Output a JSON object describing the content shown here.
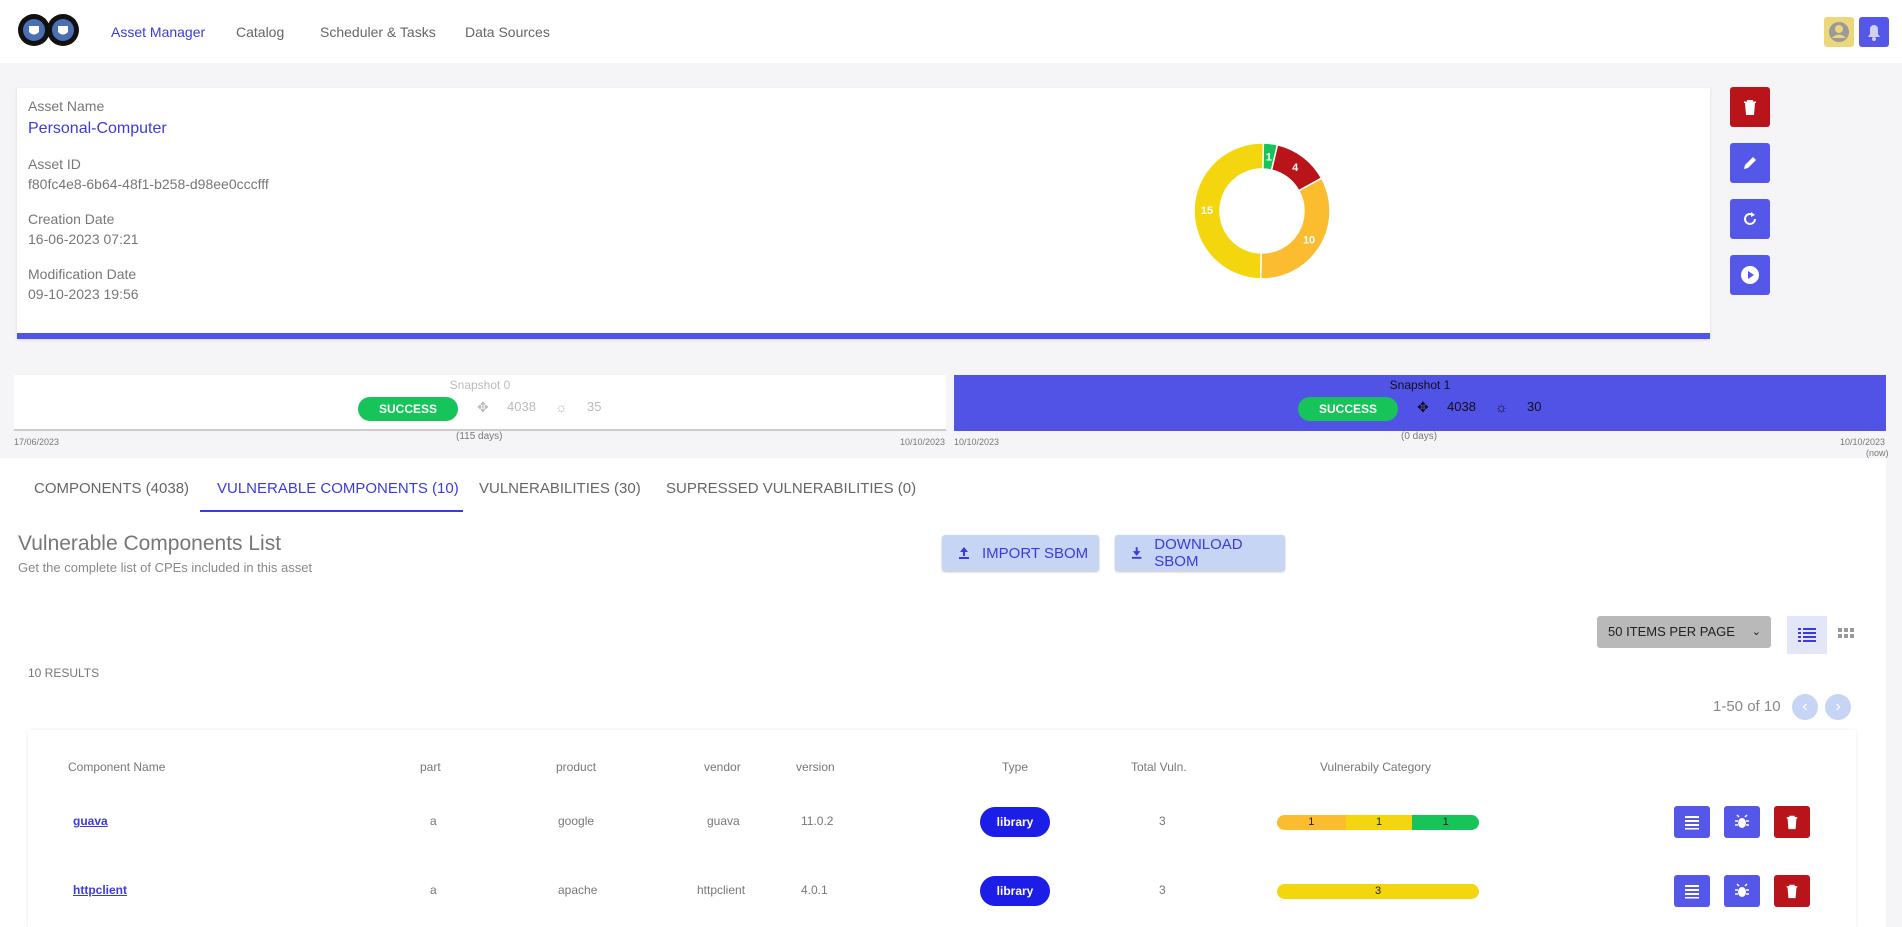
{
  "nav": {
    "items": [
      {
        "label": "Asset Manager",
        "active": true
      },
      {
        "label": "Catalog",
        "active": false
      },
      {
        "label": "Scheduler & Tasks",
        "active": false
      },
      {
        "label": "Data Sources",
        "active": false
      }
    ]
  },
  "asset": {
    "name_label": "Asset Name",
    "name": "Personal-Computer",
    "id_label": "Asset ID",
    "id": "f80fc4e8-6b64-48f1-b258-d98ee0cccfff",
    "creation_label": "Creation Date",
    "creation": "16-06-2023 07:21",
    "modification_label": "Modification Date",
    "modification": "09-10-2023 19:56"
  },
  "severity_chart": {
    "segments": [
      {
        "value": 1,
        "color": "#16c45a"
      },
      {
        "value": 4,
        "color": "#b8141a"
      },
      {
        "value": 10,
        "color": "#fbbc30"
      },
      {
        "value": 15,
        "color": "#f4d60f"
      }
    ]
  },
  "snapshots": [
    {
      "title": "Snapshot 0",
      "status": "SUCCESS",
      "components": "4038",
      "vulns": "35",
      "start": "17/06/2023",
      "duration": "(115 days)",
      "end": "10/10/2023"
    },
    {
      "title": "Snapshot 1",
      "status": "SUCCESS",
      "components": "4038",
      "vulns": "30",
      "start": "10/10/2023",
      "duration": "(0 days)",
      "end": "10/10/2023",
      "end_note": "(now)"
    }
  ],
  "tabs": [
    {
      "label": "COMPONENTS (4038)"
    },
    {
      "label": "VULNERABLE COMPONENTS (10)"
    },
    {
      "label": "VULNERABILITIES (30)"
    },
    {
      "label": "SUPRESSED VULNERABILITIES (0)"
    }
  ],
  "list": {
    "title": "Vulnerable Components List",
    "subtitle": "Get the complete list of CPEs included in this asset",
    "import_label": "IMPORT SBOM",
    "download_label": "DOWNLOAD SBOM",
    "per_page": "50 ITEMS PER PAGE",
    "results": "10 RESULTS",
    "pager": "1-50 of 10"
  },
  "table": {
    "headers": [
      "Component Name",
      "part",
      "product",
      "vendor",
      "version",
      "Type",
      "Total Vuln.",
      "Vulnerabily Category"
    ],
    "rows": [
      {
        "name": "guava",
        "part": "a",
        "product": "google",
        "vendor": "guava",
        "version": "11.0.2",
        "type": "library",
        "total": "3",
        "categories": [
          {
            "value": "1",
            "color": "#fbbc30"
          },
          {
            "value": "1",
            "color": "#f4d60f"
          },
          {
            "value": "1",
            "color": "#16c45a"
          }
        ]
      },
      {
        "name": "httpclient",
        "part": "a",
        "product": "apache",
        "vendor": "httpclient",
        "version": "4.0.1",
        "type": "library",
        "total": "3",
        "categories": [
          {
            "value": "3",
            "color": "#f4d60f"
          }
        ]
      }
    ]
  }
}
